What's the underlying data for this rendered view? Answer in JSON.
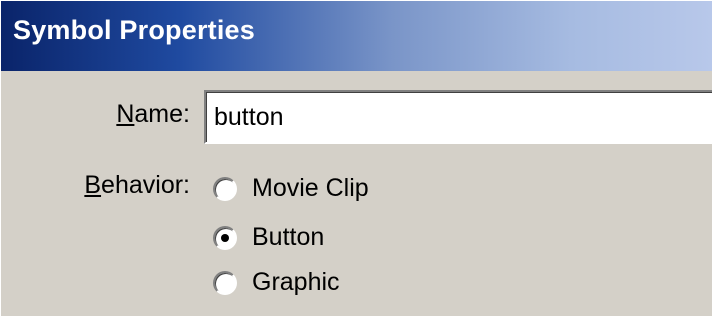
{
  "window": {
    "title": "Symbol Properties"
  },
  "form": {
    "name_label_mnemonic": "N",
    "name_label_rest": "ame:",
    "name_value": "button",
    "behavior_label_mnemonic": "B",
    "behavior_label_rest": "ehavior:",
    "behavior_options": [
      {
        "label": "Movie Clip",
        "checked": false
      },
      {
        "label": "Button",
        "checked": true
      },
      {
        "label": "Graphic",
        "checked": false
      }
    ]
  }
}
